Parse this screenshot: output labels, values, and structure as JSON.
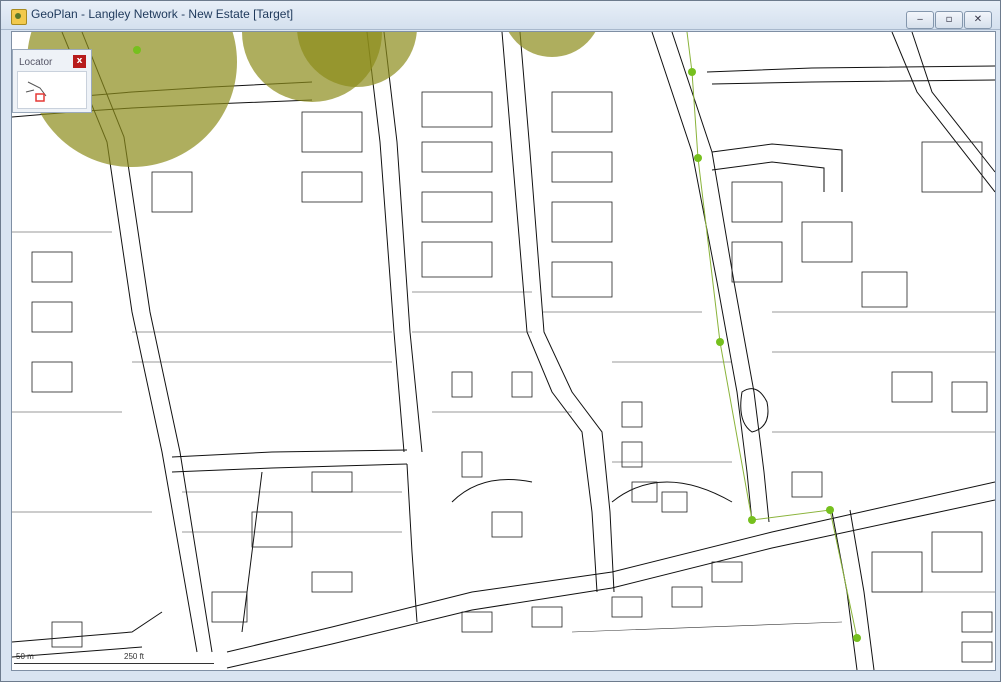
{
  "window": {
    "title": "GeoPlan - Langley Network - New Estate [Target]",
    "controls": {
      "minimize": "‒",
      "maximize": "▫",
      "close": "✕"
    }
  },
  "locator": {
    "title": "Locator",
    "close_label": "x"
  },
  "scalebar": {
    "metric_label": "50 m",
    "imperial_label": "250 ft"
  },
  "colors": {
    "catchment": "#8c8c1a",
    "pipe": "#8ab33a",
    "node": "#76c01e",
    "outline": "#111111"
  }
}
